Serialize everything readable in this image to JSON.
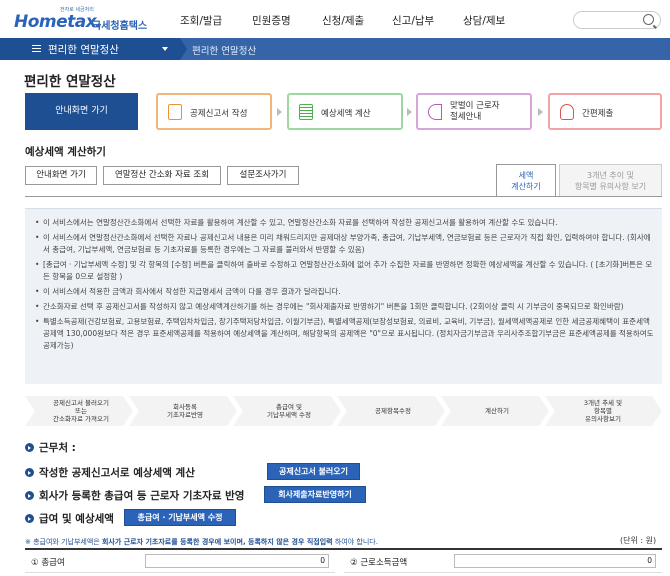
{
  "header": {
    "logo_main": "Hometax.",
    "logo_top": "전자로 세금처리",
    "logo_sub": "국세청홈택스",
    "nav": [
      "조회/발급",
      "민원증명",
      "신청/제출",
      "신고/납부",
      "상담/제보"
    ]
  },
  "bar": {
    "menu_label": "편리한 연말정산",
    "breadcrumb": "편리한 연말정산"
  },
  "page_title": "편리한 연말정산",
  "steps": {
    "home": "안내화면 가기",
    "s1": "공제신고서 작성",
    "s2": "예상세액 계산",
    "s3_line1": "맞벌이 근로자",
    "s3_line2": "절세안내",
    "s4": "간편제출"
  },
  "section_title": "예상세액 계산하기",
  "buttons": [
    "안내화면 가기",
    "연말정산 간소화 자료 조회",
    "설문조사가기"
  ],
  "tabs": {
    "t1_line1": "세액",
    "t1_line2": "계산하기",
    "t2_line1": "3개년 추이 및",
    "t2_line2": "항목별 유의사항 보기"
  },
  "info": [
    "이 서비스에서는 연말정산간소화에서 선택한 자료를 활용하여 계산할 수 있고, 연말정산간소화 자료를 선택하여 작성한 공제신고서를 활용하여 계산할 수도 있습니다.",
    "이 서비스에서 연말정산간소화에서 선택한 자료나 공제신고서 내용은 미리 채워드리지만 공제대상 부양가족, 총급여, 기납부세액, 연금보험료 등은 근로자가 직접 확인, 입력하여야 합니다. (회사에서 총급여, 기납부세액, 연금보험료 등 기초자료를 등록한 경우에는 그 자료를 불러와서 반영할 수 있음)",
    "[총급여 · 기납부세액 수정] 및 각 항목의 [수정] 버튼을 클릭하여 출바로 수정하고 연말정산간소화에 없어 추가 수집한 자료를 반영하면 정확한 예상세액을 계산할 수 있습니다. ( [초기화]버튼은 모든 항목을 0으로 설정함 )",
    "이 서비스에서 적용한 금액과 회사에서 작성한 지급명세서 금액이 다를 경우 결과가 달라집니다.",
    "간소화자료 선택 후 공제신고서를 작성하지 않고 예상세액계산하기를 하는 경우에는 \"회사제출자료 반영하기\" 버튼을 1회만 클릭합니다. (2회이상 클릭 시 기부금이 중복되므로 확인바람)",
    "특별소득공제(건강보험료, 고용보험료, 주택임차차입금, 장기주택저당차입금, 이월기부금), 특별세액공제(보장성보험료, 의료비, 교육비, 기부금), 월세액세액공제로 인한 세금공제혜택이 표준세액공제액 130,000원보다 적은 경우 표준세액공제를 적용하여 예상세액을 계산하며, 해당항목의 공제액은 \"0\"으로 표시됩니다. (정치자금기부금과 우리사주조합기부금은 표준세액공제를 적용하여도 공제가능)"
  ],
  "flow": [
    [
      "공제신고서 불러오기",
      "또는",
      "간소화자료 가져오기"
    ],
    [
      "회사등록",
      "기초자료반영"
    ],
    [
      "총급여 및",
      "기납부세액 수정"
    ],
    [
      "공제항목수정"
    ],
    [
      "계산하기"
    ],
    [
      "3개년 추세 및",
      "항목별",
      "유의사항보기"
    ]
  ],
  "rows": {
    "r0": "근무처 :",
    "r1": "작성한 공제신고서로 예상세액 계산",
    "r1_btn": "공제신고서 불러오기",
    "r2": "회사가 등록한 총급여 등 근로자 기초자료 반영",
    "r2_btn": "회사제출자료반영하기",
    "r3": "급여 및 예상세액",
    "r3_btn": "총급여 · 기납부세액 수정"
  },
  "note_prefix": "※ 총급여와 기납부세액은",
  "note_bold": "회사가 근로자 기초자료를 등록한 경우에 보이며, 등록하지 않은 경우 직접입력",
  "note_suffix": "하여야 합니다.",
  "unit": "(단위 : 원)",
  "bottom": {
    "l1": "① 총급여",
    "v1": "0",
    "l2": "② 근로소득금액",
    "v2": "0"
  }
}
